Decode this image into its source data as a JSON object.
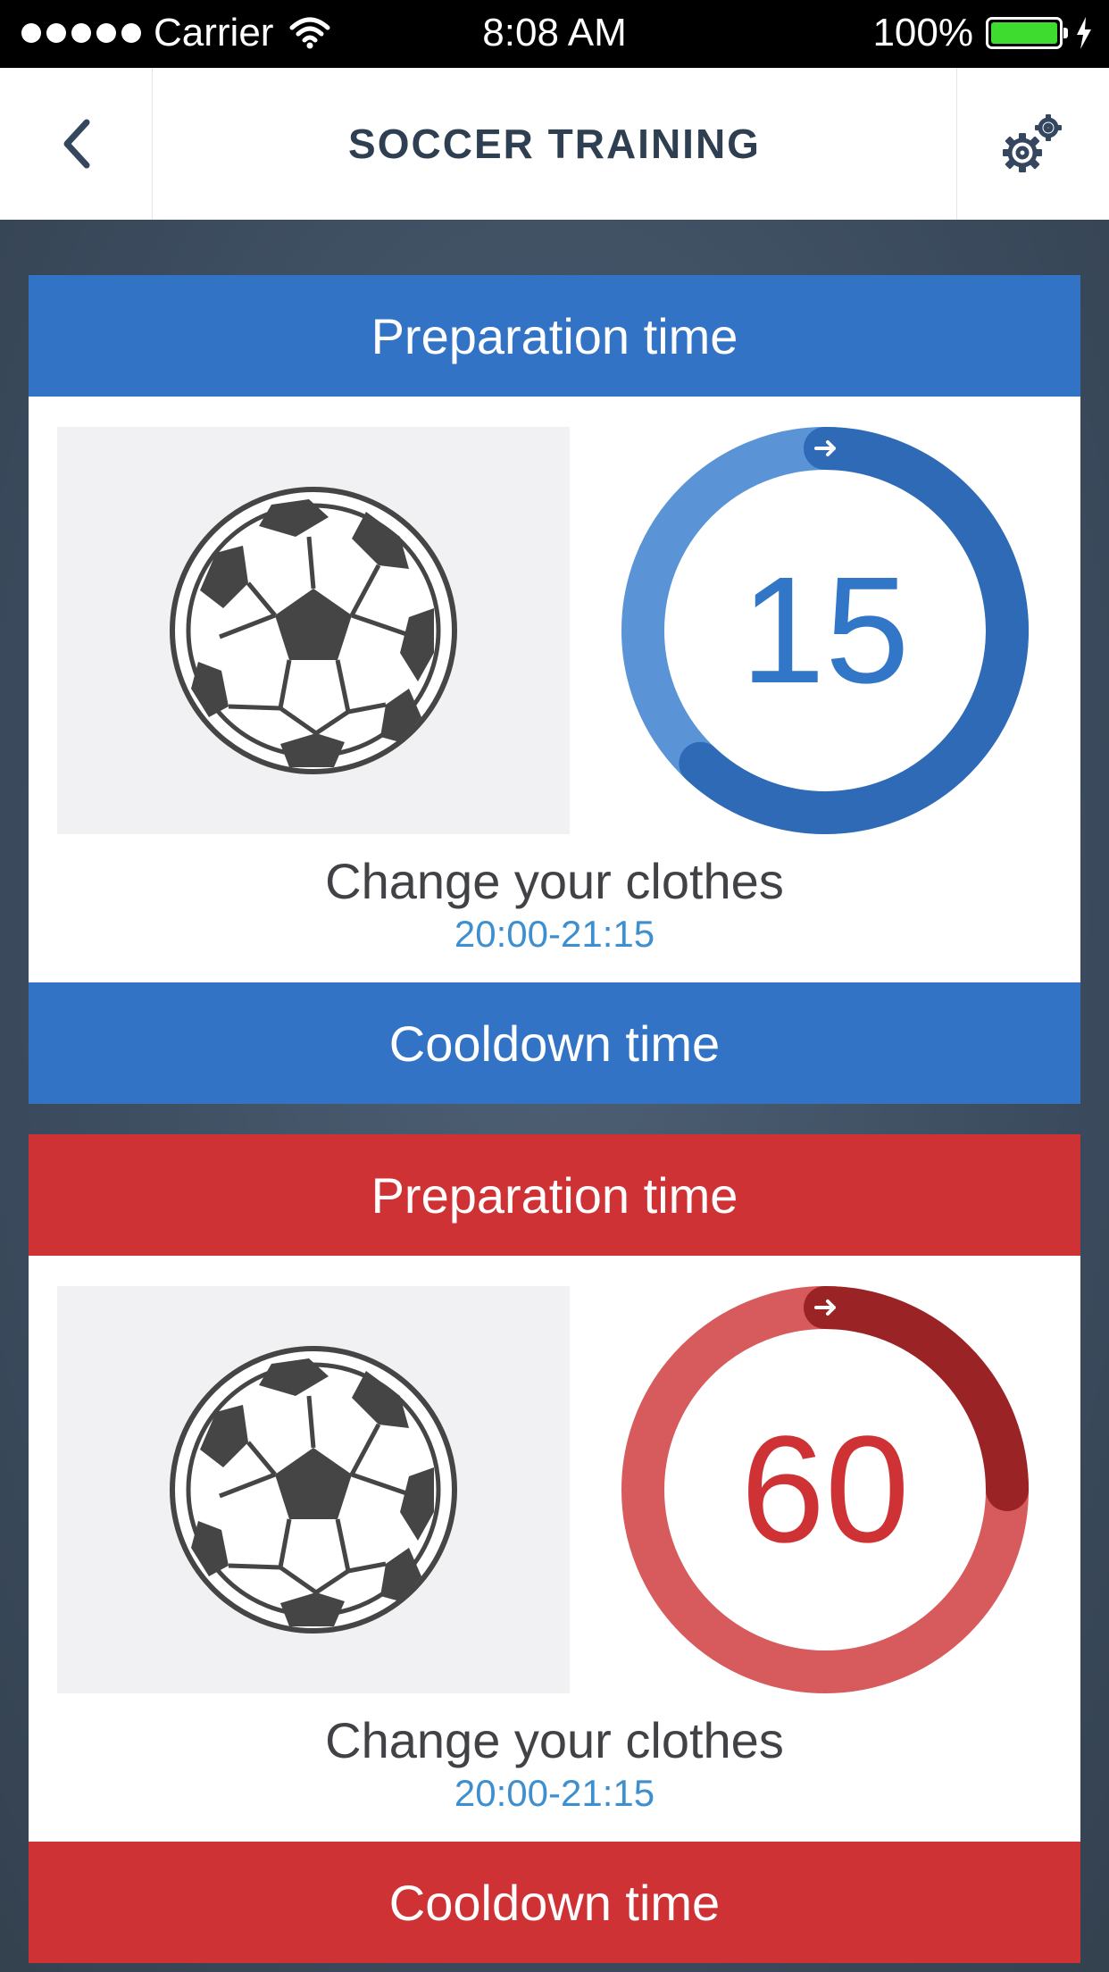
{
  "status_bar": {
    "carrier": "Carrier",
    "time": "8:08 AM",
    "battery_text": "100%"
  },
  "nav": {
    "title": "SOCCER TRAINING",
    "back_icon": "chevron-left-icon",
    "settings_icon": "gears-icon"
  },
  "cards": [
    {
      "theme": "blue",
      "header": "Preparation time",
      "timer_value": "15",
      "progress_fraction": 0.62,
      "activity": "Change your clothes",
      "time_range": "20:00-21:15",
      "footer": "Cooldown time",
      "colors": {
        "ring": "#5b94d6",
        "progress": "#2f6ab6",
        "accent": "#3273c5"
      }
    },
    {
      "theme": "red",
      "header": "Preparation time",
      "timer_value": "60",
      "progress_fraction": 0.25,
      "activity": "Change your clothes",
      "time_range": "20:00-21:15",
      "footer": "Cooldown time",
      "colors": {
        "ring": "#d75a5c",
        "progress": "#9a2326",
        "accent": "#cf3235"
      }
    }
  ]
}
